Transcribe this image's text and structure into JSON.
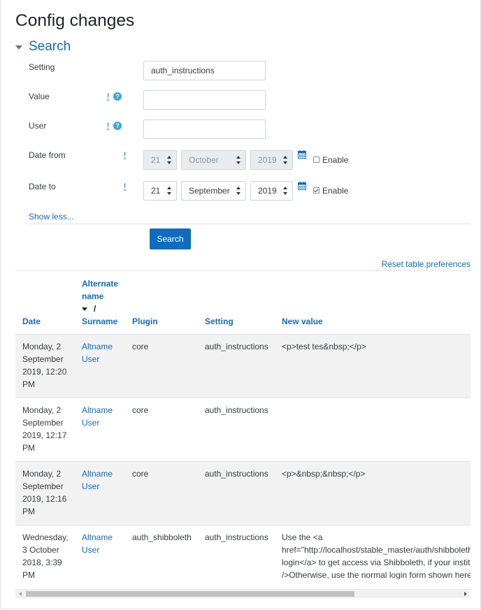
{
  "page": {
    "title": "Config changes"
  },
  "search": {
    "legend": "Search",
    "fields": {
      "setting": {
        "label": "Setting",
        "value": "auth_instructions"
      },
      "value": {
        "label": "Value",
        "value": ""
      },
      "user": {
        "label": "User",
        "value": ""
      }
    },
    "required_marker": "!",
    "help_glyph": "?",
    "date_from": {
      "label": "Date from",
      "day": "21",
      "month": "October",
      "year": "2019",
      "enabled": false,
      "enable_label": "Enable"
    },
    "date_to": {
      "label": "Date to",
      "day": "21",
      "month": "September",
      "year": "2019",
      "enabled": true,
      "enable_label": "Enable"
    },
    "show_less": "Show less...",
    "submit_label": "Search"
  },
  "table": {
    "reset_link": "Reset table preferences",
    "headers": {
      "date": "Date",
      "user_line1": "Alternate",
      "user_line2": "name",
      "user_slash": "/",
      "user_line4": "Surname",
      "plugin": "Plugin",
      "setting": "Setting",
      "new_value": "New value"
    },
    "rows": [
      {
        "date": "Monday, 2 September 2019, 12:20 PM",
        "user1": "Altname",
        "user2": "User",
        "plugin": "core",
        "setting": "auth_instructions",
        "value1": "<p>test tes&nbsp;</p>",
        "value2": "",
        "value3": ""
      },
      {
        "date": "Monday, 2 September 2019, 12:17 PM",
        "user1": "Altname",
        "user2": "User",
        "plugin": "core",
        "setting": "auth_instructions",
        "value1": "",
        "value2": "",
        "value3": ""
      },
      {
        "date": "Monday, 2 September 2019, 12:16 PM",
        "user1": "Altname",
        "user2": "User",
        "plugin": "core",
        "setting": "auth_instructions",
        "value1": "<p>&nbsp;&nbsp;</p>",
        "value2": "",
        "value3": ""
      },
      {
        "date": "Wednesday, 3 October 2018, 3:39 PM",
        "user1": "Altname",
        "user2": "User",
        "plugin": "auth_shibboleth",
        "setting": "auth_instructions",
        "value1": "Use the <a",
        "value2": "href=\"http://localhost/stable_master/auth/shibboleth/index.php\">Shibboleth",
        "value3": "login</a> to get access via Shibboleth, if your institution supports it.<br",
        "value4": "/>Otherwise, use the normal login form shown here."
      }
    ]
  },
  "colors": {
    "link": "#0f6cbf",
    "button": "#0f6cbf",
    "help": "#39a5d6",
    "row_stripe": "#f2f2f2"
  },
  "icons": {
    "calendar": "calendar-icon",
    "help": "help-icon",
    "sort": "sort-desc-icon"
  }
}
